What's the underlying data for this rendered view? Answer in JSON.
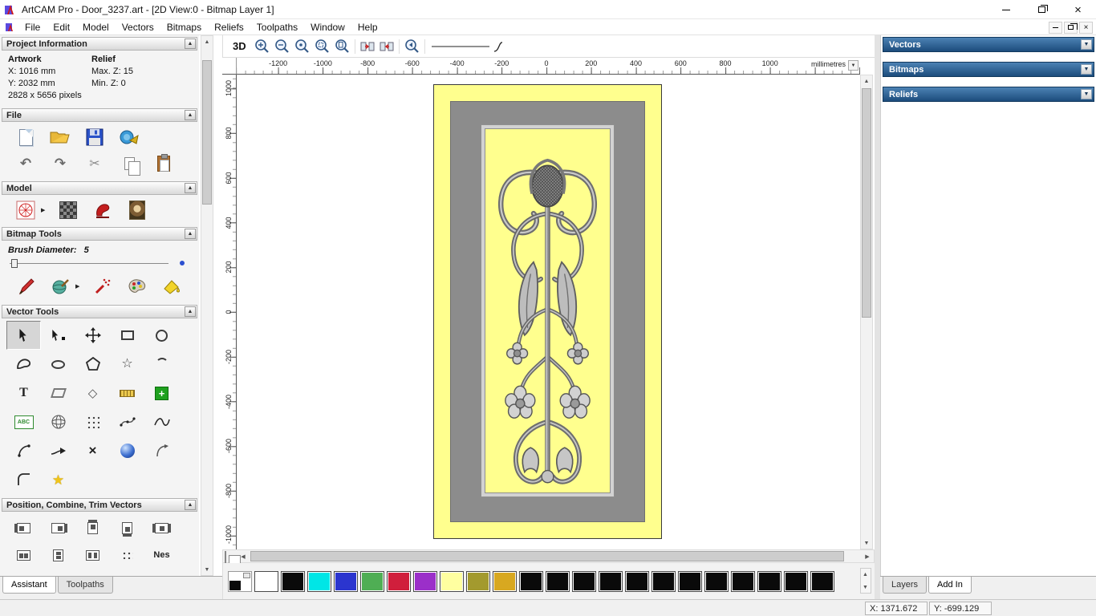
{
  "titlebar": {
    "title": "ArtCAM Pro - Door_3237.art - [2D View:0 - Bitmap Layer 1]"
  },
  "menubar": {
    "items": [
      "File",
      "Edit",
      "Model",
      "Vectors",
      "Bitmaps",
      "Reliefs",
      "Toolpaths",
      "Window",
      "Help"
    ]
  },
  "left_panel": {
    "project_information": {
      "title": "Project Information",
      "artwork": {
        "label": "Artwork",
        "x": "X: 1016 mm",
        "y": "Y: 2032 mm",
        "pixels": "2828 x 5656 pixels"
      },
      "relief": {
        "label": "Relief",
        "max": "Max. Z: 15",
        "min": "Min. Z: 0"
      }
    },
    "file_section": {
      "title": "File"
    },
    "model_section": {
      "title": "Model"
    },
    "bitmap_tools": {
      "title": "Bitmap Tools",
      "brush_label": "Brush Diameter:",
      "brush_value": "5"
    },
    "vector_tools": {
      "title": "Vector Tools"
    },
    "position_section": {
      "title": "Position, Combine, Trim Vectors",
      "nest_label": "Nes"
    },
    "tabs": [
      {
        "label": "Assistant"
      },
      {
        "label": "Toolpaths"
      }
    ]
  },
  "canvas": {
    "toolbar": {
      "btn_3d": "3D"
    },
    "hruler": {
      "labels": [
        "-1200",
        "-1000",
        "-800",
        "-600",
        "-400",
        "-200",
        "0",
        "200",
        "400",
        "600",
        "800",
        "1000"
      ],
      "unit": "millimetres"
    },
    "vruler": {
      "labels": [
        "1000",
        "800",
        "600",
        "400",
        "200",
        "0",
        "-200",
        "-400",
        "-600",
        "-800",
        "-1000"
      ]
    }
  },
  "right_panel": {
    "sections": [
      {
        "title": "Vectors"
      },
      {
        "title": "Bitmaps"
      },
      {
        "title": "Reliefs"
      }
    ],
    "tabs": [
      {
        "label": "Layers"
      },
      {
        "label": "Add In"
      }
    ]
  },
  "palette": {
    "colors": [
      "#ffffff",
      "#0a0a0a",
      "#00e6e6",
      "#2b35cf",
      "#4fae54",
      "#d01f3c",
      "#9b2fc9",
      "#ffffa0",
      "#a39a2e",
      "#d8a820",
      "#0a0a0a",
      "#0a0a0a",
      "#0a0a0a",
      "#0a0a0a",
      "#0a0a0a",
      "#0a0a0a",
      "#0a0a0a",
      "#0a0a0a",
      "#0a0a0a",
      "#0a0a0a",
      "#0a0a0a",
      "#0a0a0a"
    ]
  },
  "statusbar": {
    "x": "X: 1371.672",
    "y": "Y: -699.129"
  },
  "icons": {
    "minimize": "–",
    "close": "×",
    "undo": "↶",
    "redo": "↷",
    "cut": "✂",
    "star_outline": "☆",
    "star_filled": "★",
    "diamond": "◇",
    "text_tool": "T",
    "abc": "ABC",
    "collapse_up": "▲",
    "dropdown_down": "▼",
    "arrow_up": "▲",
    "arrow_down": "▼",
    "arrow_left": "◀",
    "arrow_right": "▶",
    "plus": "+",
    "multiply": "×"
  }
}
